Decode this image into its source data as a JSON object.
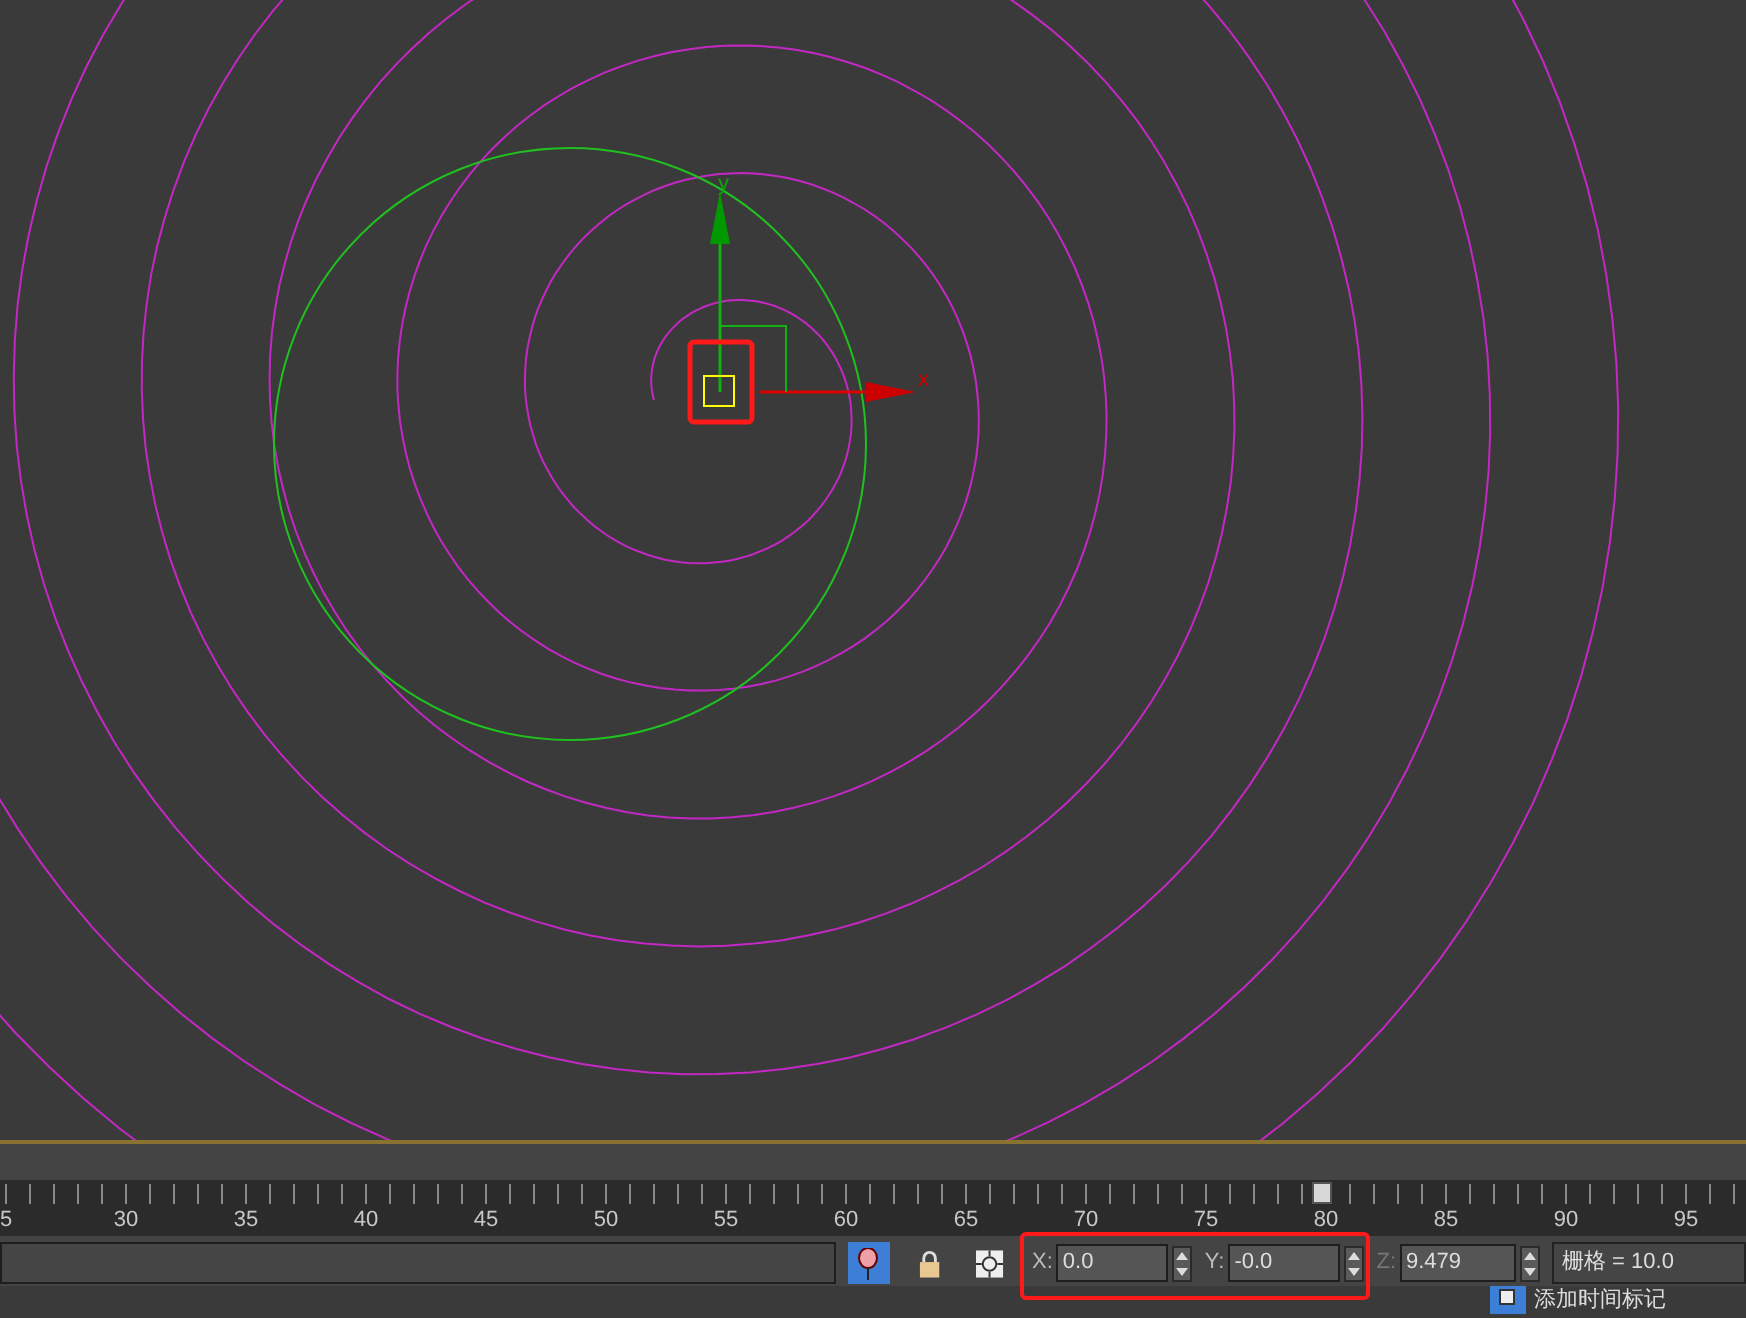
{
  "viewport": {
    "gizmo": {
      "y_label": "y",
      "x_label": "x"
    }
  },
  "timeline": {
    "labels": [
      "5",
      "30",
      "35",
      "40",
      "45",
      "50",
      "55",
      "60",
      "65",
      "70",
      "75",
      "80",
      "85",
      "90",
      "95"
    ],
    "level": 0.757
  },
  "status_bar": {
    "pin_selected": true,
    "coords": [
      {
        "label": "X:",
        "value": "0.0"
      },
      {
        "label": "Y:",
        "value": "-0.0"
      },
      {
        "label": "Z:",
        "value": "9.479"
      }
    ],
    "grid": "栅格 = 10.0",
    "time_tag": "添加时间标记"
  }
}
